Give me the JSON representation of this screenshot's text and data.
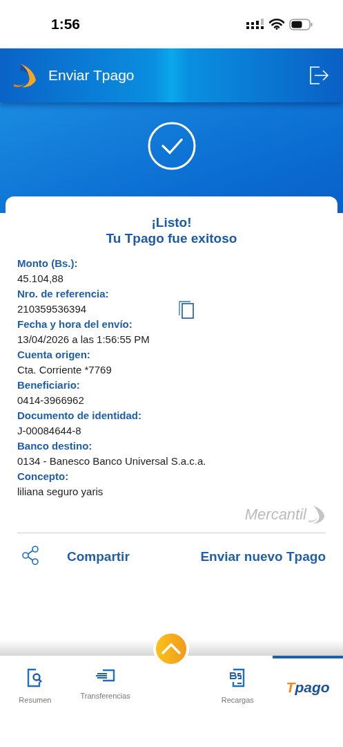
{
  "status_bar": {
    "time": "1:56"
  },
  "header": {
    "title": "Enviar Tpago"
  },
  "receipt": {
    "title_lines": [
      "¡Listo!",
      "Tu Tpago fue exitoso"
    ],
    "fields": [
      {
        "label": "Monto (Bs.):",
        "value": "45.104,88",
        "copy": false
      },
      {
        "label": "Nro. de referencia:",
        "value": "210359536394",
        "copy": true
      },
      {
        "label": "Fecha y hora del envío:",
        "value": "13/04/2026 a las 1:56:55 PM",
        "copy": false
      },
      {
        "label": "Cuenta origen:",
        "value": "Cta. Corriente *7769",
        "copy": false
      },
      {
        "label": "Beneficiario:",
        "value": "0414-3966962",
        "copy": false
      },
      {
        "label": "Documento de identidad:",
        "value": "J-00084644-8",
        "copy": false
      },
      {
        "label": "Banco destino:",
        "value": "0134 - Banesco Banco Universal S.a.c.a.",
        "copy": false
      },
      {
        "label": "Concepto:",
        "value": "liliana seguro yaris",
        "copy": false
      }
    ],
    "brand": "Mercantil",
    "actions": [
      {
        "kind": "share",
        "label": "Compartir"
      },
      {
        "kind": "plain",
        "label": "Enviar nuevo Tpago"
      }
    ]
  },
  "bottom_nav": [
    {
      "kind": "summary",
      "label": "Resumen",
      "selected": false
    },
    {
      "kind": "transfer",
      "label": "Transferencias",
      "selected": false
    },
    {
      "kind": "up",
      "selected": false
    },
    {
      "kind": "recharge",
      "label": "Recargas",
      "selected": false
    },
    {
      "kind": "logo",
      "label": "Tpago",
      "selected": true
    }
  ]
}
